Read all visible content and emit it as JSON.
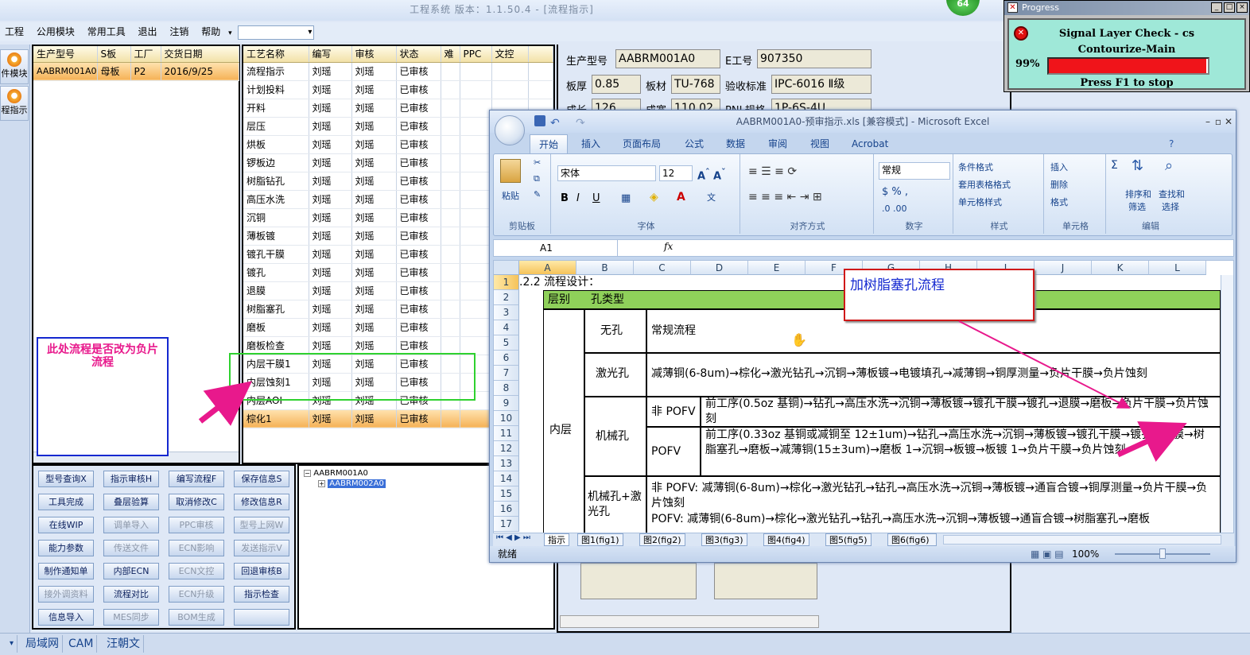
{
  "app": {
    "title": "工程系统   版本：1.1.50.4 - [流程指示]",
    "badge": "64"
  },
  "menu": [
    "工程",
    "公用模块",
    "常用工具",
    "退出",
    "注销",
    "帮助"
  ],
  "left_strip": [
    "件模块",
    "程指示"
  ],
  "order_grid": {
    "headers": [
      "生产型号",
      "S板",
      "工厂",
      "交货日期"
    ],
    "rows": [
      [
        "AABRM001A0",
        "母板",
        "P2",
        "2016/9/25"
      ]
    ]
  },
  "annotation_left": "此处流程是否改为负片流程",
  "process_grid": {
    "headers": [
      "工艺名称",
      "编写",
      "审核",
      "状态",
      "难",
      "PPC",
      "文控"
    ],
    "rows": [
      [
        "流程指示",
        "刘瑶",
        "刘瑶",
        "已审核"
      ],
      [
        "计划投料",
        "刘瑶",
        "刘瑶",
        "已审核"
      ],
      [
        "开料",
        "刘瑶",
        "刘瑶",
        "已审核"
      ],
      [
        "层压",
        "刘瑶",
        "刘瑶",
        "已审核"
      ],
      [
        "烘板",
        "刘瑶",
        "刘瑶",
        "已审核"
      ],
      [
        "锣板边",
        "刘瑶",
        "刘瑶",
        "已审核"
      ],
      [
        "树脂钻孔",
        "刘瑶",
        "刘瑶",
        "已审核"
      ],
      [
        "高压水洗",
        "刘瑶",
        "刘瑶",
        "已审核"
      ],
      [
        "沉铜",
        "刘瑶",
        "刘瑶",
        "已审核"
      ],
      [
        "薄板镀",
        "刘瑶",
        "刘瑶",
        "已审核"
      ],
      [
        "镀孔干膜",
        "刘瑶",
        "刘瑶",
        "已审核"
      ],
      [
        "镀孔",
        "刘瑶",
        "刘瑶",
        "已审核"
      ],
      [
        "退膜",
        "刘瑶",
        "刘瑶",
        "已审核"
      ],
      [
        "树脂塞孔",
        "刘瑶",
        "刘瑶",
        "已审核"
      ],
      [
        "磨板",
        "刘瑶",
        "刘瑶",
        "已审核"
      ],
      [
        "磨板检查",
        "刘瑶",
        "刘瑶",
        "已审核"
      ],
      [
        "内层干膜1",
        "刘瑶",
        "刘瑶",
        "已审核"
      ],
      [
        "内层蚀刻1",
        "刘瑶",
        "刘瑶",
        "已审核"
      ],
      [
        "内层AOI",
        "刘瑶",
        "刘瑶",
        "已审核"
      ],
      [
        "棕化1",
        "刘瑶",
        "刘瑶",
        "已审核"
      ]
    ]
  },
  "buttons": [
    [
      "型号查询X",
      "指示审核H",
      "编写流程F",
      "保存信息S"
    ],
    [
      "工具完成",
      "叠层验算",
      "取消修改C",
      "修改信息R"
    ],
    [
      "在线WIP",
      "调单导入",
      "PPC审核",
      "型号上网W"
    ],
    [
      "能力参数",
      "传送文件",
      "ECN影响",
      "发送指示V"
    ],
    [
      "制作通知单",
      "内部ECN",
      "ECN文控",
      "回退审核B"
    ],
    [
      "接外调资料",
      "流程对比",
      "ECN升级",
      "指示检查"
    ],
    [
      "信息导入",
      "MES同步",
      "BOM生成",
      ""
    ]
  ],
  "tree": {
    "root": "AABRM001A0",
    "child": "AABRM002A0"
  },
  "detail": {
    "l1": "生产型号",
    "v1": "AABRM001A0",
    "l2": "E工号",
    "v2": "907350",
    "l3": "板厚",
    "v3": "0.85",
    "l4": "板材",
    "v4": "TU-768",
    "l5": "验收标准",
    "v5": "IPC-6016 Ⅱ级",
    "l6": "成长",
    "v6": "126",
    "l7": "成宽",
    "v7": "110.02",
    "l8": "PNL规格",
    "v8": "1P-6S-4U"
  },
  "progress": {
    "title": "Progress",
    "line1": "Signal Layer Check - cs",
    "line2": "Contourize-Main",
    "percent": "99%",
    "value": 0.99,
    "stop": "Press F1 to stop"
  },
  "excel": {
    "title": "AABRM001A0-预审指示.xls  [兼容模式] - Microsoft Excel",
    "tabs": [
      "开始",
      "插入",
      "页面布局",
      "公式",
      "数据",
      "审阅",
      "视图",
      "Acrobat"
    ],
    "groups": [
      "剪贴板",
      "字体",
      "对齐方式",
      "数字",
      "样式",
      "单元格",
      "编辑"
    ],
    "paste": "粘贴",
    "font": "宋体",
    "size": "12",
    "numfmt": "常规",
    "style_items": [
      "条件格式",
      "套用表格格式",
      "单元格样式"
    ],
    "cell_items": [
      "插入",
      "删除",
      "格式"
    ],
    "edit_items": [
      "排序和",
      "筛选",
      "查找和",
      "选择"
    ],
    "namebox": "A1",
    "fx": "fx",
    "cols": [
      "A",
      "B",
      "C",
      "D",
      "E",
      "F",
      "G",
      "H",
      "I",
      "J",
      "K",
      "L"
    ],
    "rows": [
      "1",
      "2",
      "3",
      "4",
      "5",
      "6",
      "7",
      "8",
      "9",
      "10",
      "11",
      "12",
      "13",
      "14",
      "15",
      "16",
      "17"
    ],
    "heading": ".2.2 流程设计：",
    "th1": "层别",
    "th2": "孔类型",
    "c_none": "无孔",
    "c_none_v": "常规流程",
    "c_laser": "激光孔",
    "c_laser_v": "减薄铜(6-8um)→棕化→激光钻孔→沉铜→薄板镀→电镀填孔→减薄铜→铜厚测量→负片干膜→负片蚀刻",
    "c_layer": "内层",
    "c_mech": "机械孔",
    "c_np": "非 POFV",
    "c_np_v": "前工序(0.5oz 基铜)→钻孔→高压水洗→沉铜→薄板镀→镀孔干膜→镀孔→退膜→磨板→负片干膜→负片蚀刻",
    "c_p": "POFV",
    "c_p_v": "前工序(0.33oz 基铜或减铜至 12±1um)→钻孔→高压水洗→沉铜→薄板镀→镀孔干膜→镀孔→退膜→树脂塞孔→磨板→减薄铜(15±3um)→磨板 1→沉铜→板镀→板镀 1→负片干膜→负片蚀刻",
    "c_ml": "机械孔+激光孔",
    "c_ml_v": "非 POFV: 减薄铜(6-8um)→棕化→激光钻孔→钻孔→高压水洗→沉铜→薄板镀→通盲合镀→铜厚测量→负片干膜→负片蚀刻",
    "c_ml2": "POFV: 减薄铜(6-8um)→棕化→激光钻孔→钻孔→高压水洗→沉铜→薄板镀→通盲合镀→树脂塞孔→磨板",
    "callout": "加树脂塞孔流程",
    "sheets": [
      "指示",
      "图1(fig1)",
      "图2(fig2)",
      "图3(fig3)",
      "图4(fig4)",
      "图5(fig5)",
      "图6(fig6)"
    ],
    "status": "就绪",
    "zoom": "100%"
  },
  "bottom": [
    "局域网",
    "CAM",
    "汪朝文"
  ],
  "colors": {
    "accent": "#f5b257",
    "callout_border": "#d01818",
    "arrow": "#e8198c",
    "green_box": "#2fd12f",
    "blue_box": "#1428d0"
  }
}
